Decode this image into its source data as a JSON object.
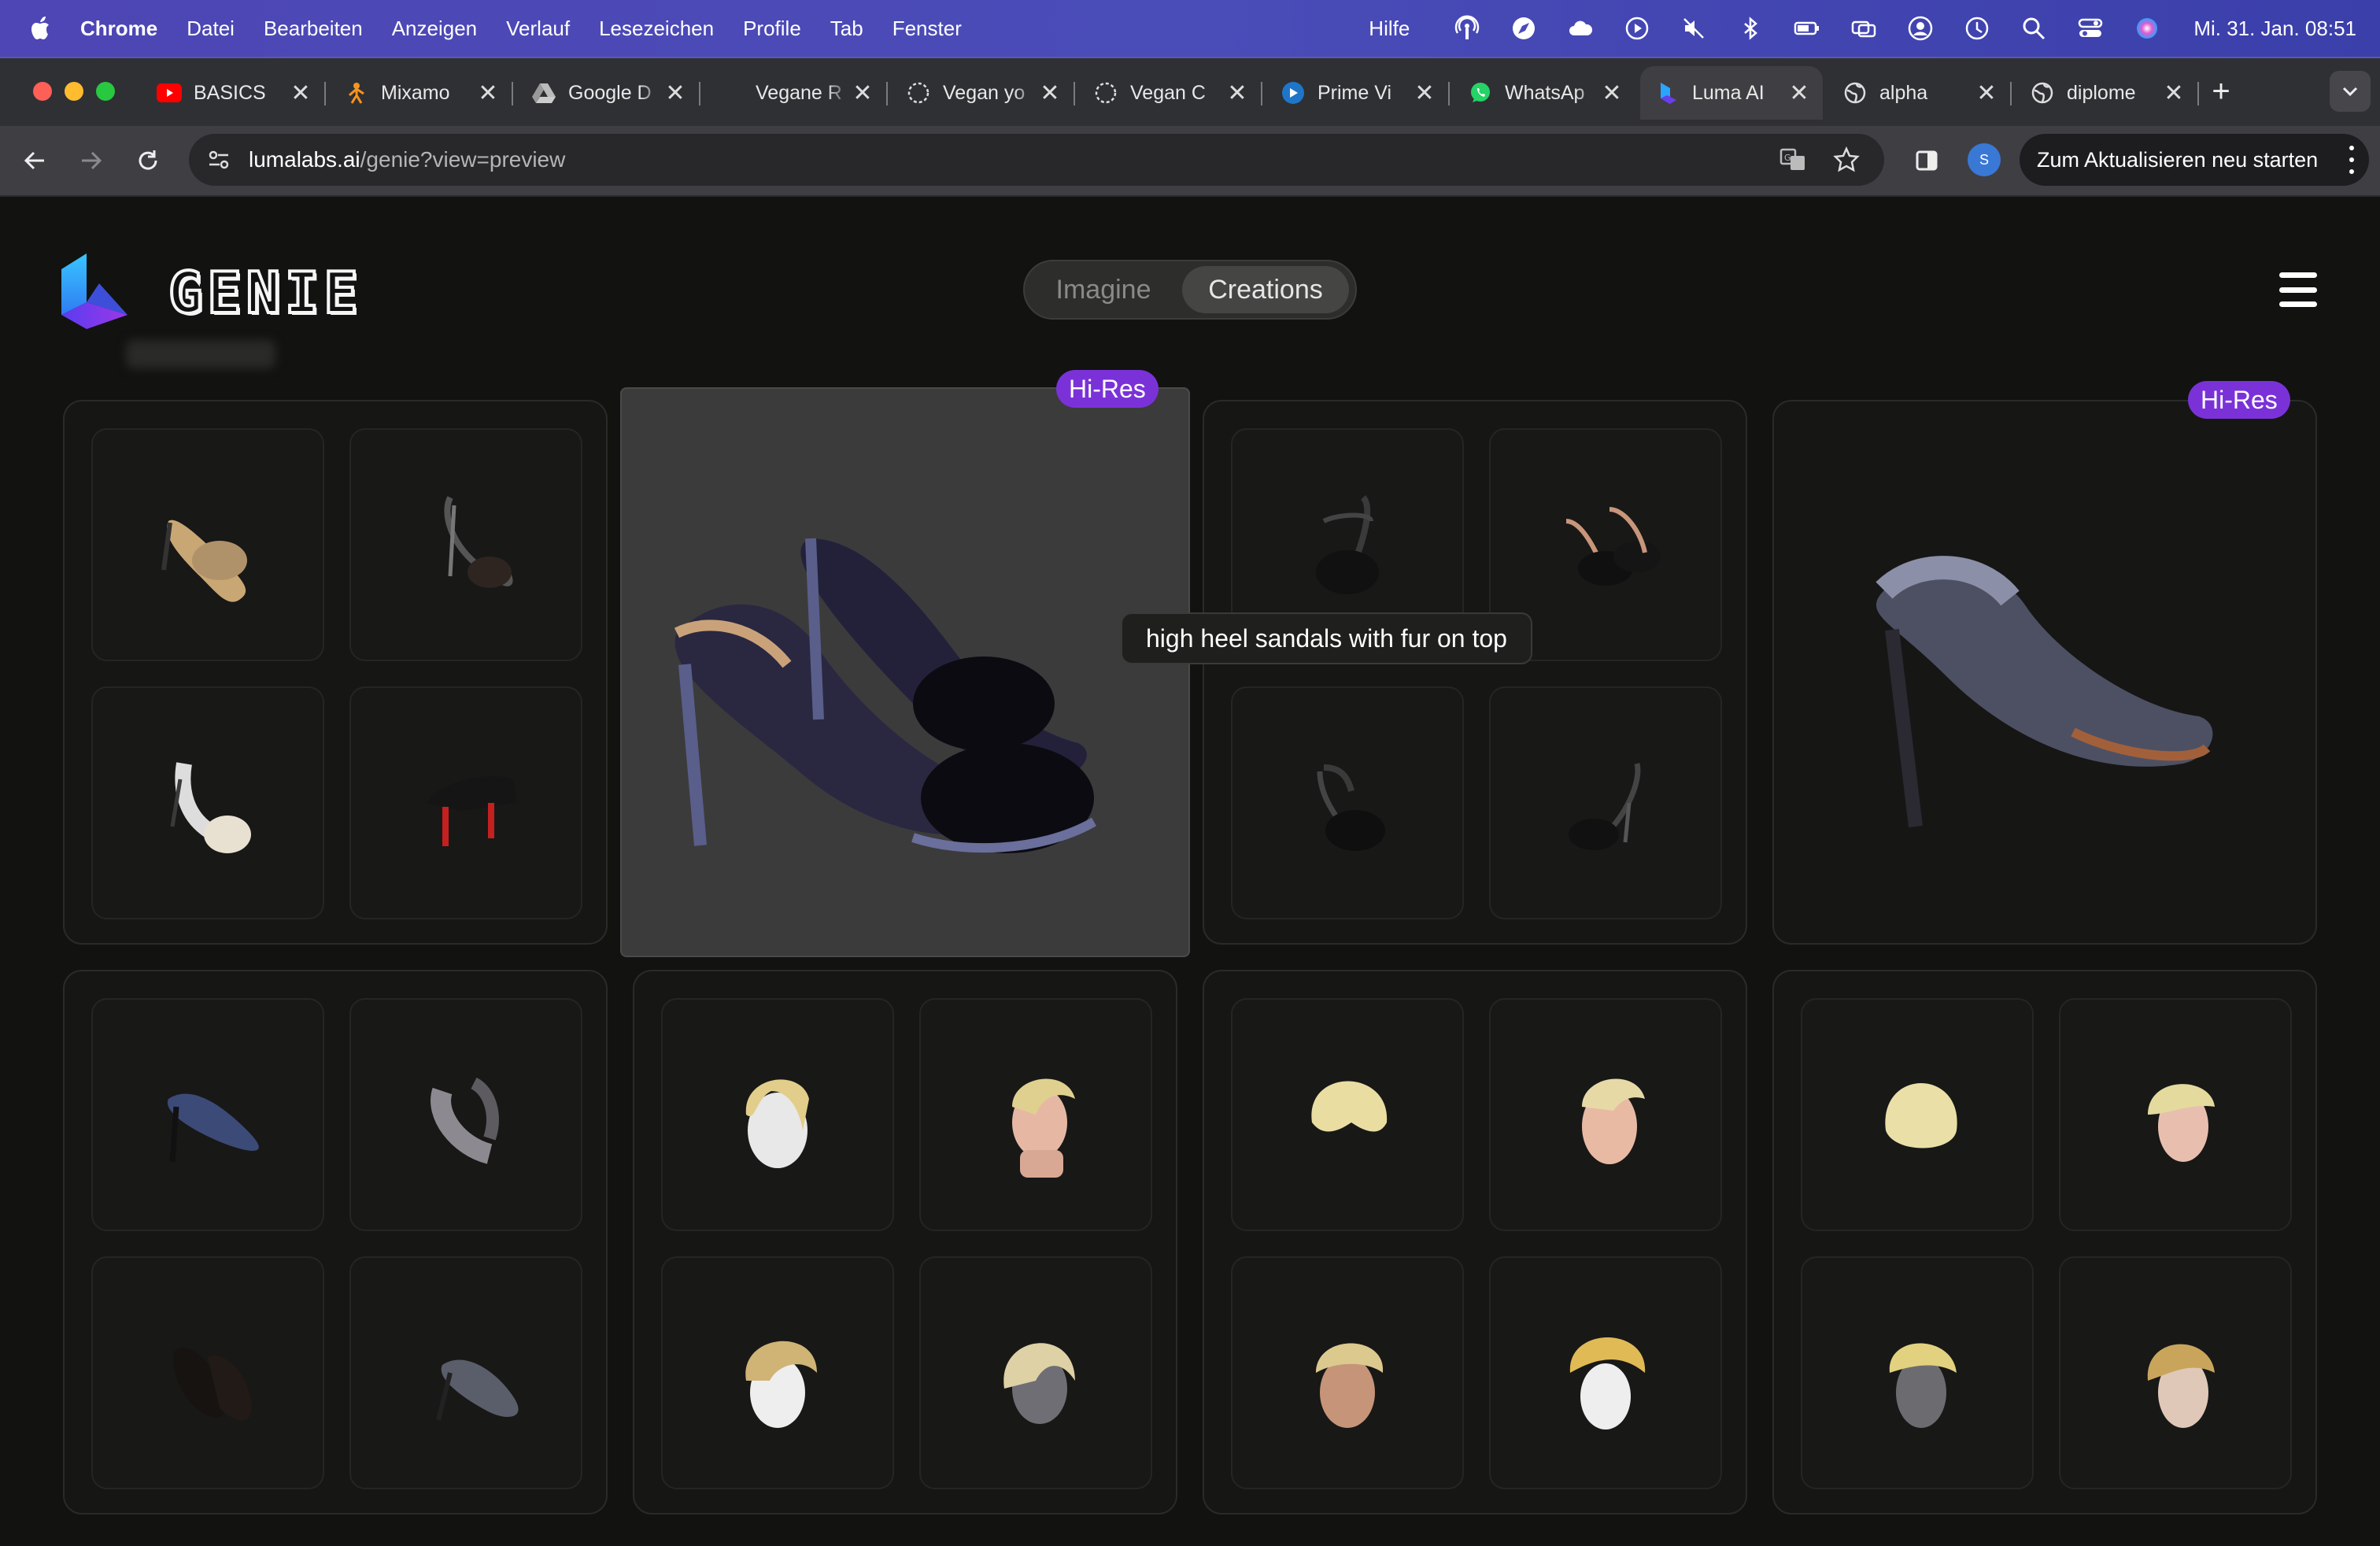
{
  "menubar": {
    "app": "Chrome",
    "items": [
      "Datei",
      "Bearbeiten",
      "Anzeigen",
      "Verlauf",
      "Lesezeichen",
      "Profile",
      "Tab",
      "Fenster"
    ],
    "help": "Hilfe",
    "clock": "Mi. 31. Jan.  08:51"
  },
  "tabs": [
    {
      "title": "BASICS",
      "icon": "youtube-icon"
    },
    {
      "title": "Mixamo",
      "icon": "mixamo-icon"
    },
    {
      "title": "Google D",
      "icon": "google-drive-icon"
    },
    {
      "title": "Vegane R",
      "icon": "none"
    },
    {
      "title": "Vegan yo",
      "icon": "loading-icon"
    },
    {
      "title": "Vegan C",
      "icon": "loading-icon"
    },
    {
      "title": "Prime Vi",
      "icon": "prime-video-icon"
    },
    {
      "title": "WhatsAp",
      "icon": "whatsapp-icon"
    },
    {
      "title": "Luma AI",
      "icon": "luma-icon"
    },
    {
      "title": "alpha",
      "icon": "globe-icon"
    },
    {
      "title": "diplome",
      "icon": "globe-icon"
    }
  ],
  "toolbar": {
    "url_host": "lumalabs.ai",
    "url_path": "/genie?view=preview",
    "profile_initial": "S",
    "restart_label": "Zum Aktualisieren neu starten"
  },
  "page": {
    "brand": "GENIE",
    "switcher": {
      "imagine": "Imagine",
      "creations": "Creations"
    },
    "hires_label": "Hi-Res",
    "tooltip": "high heel sandals with fur on top"
  },
  "colors": {
    "accent_purple": "#7a32d8",
    "page_bg": "#121211",
    "menubar": "#4a4cb8"
  }
}
